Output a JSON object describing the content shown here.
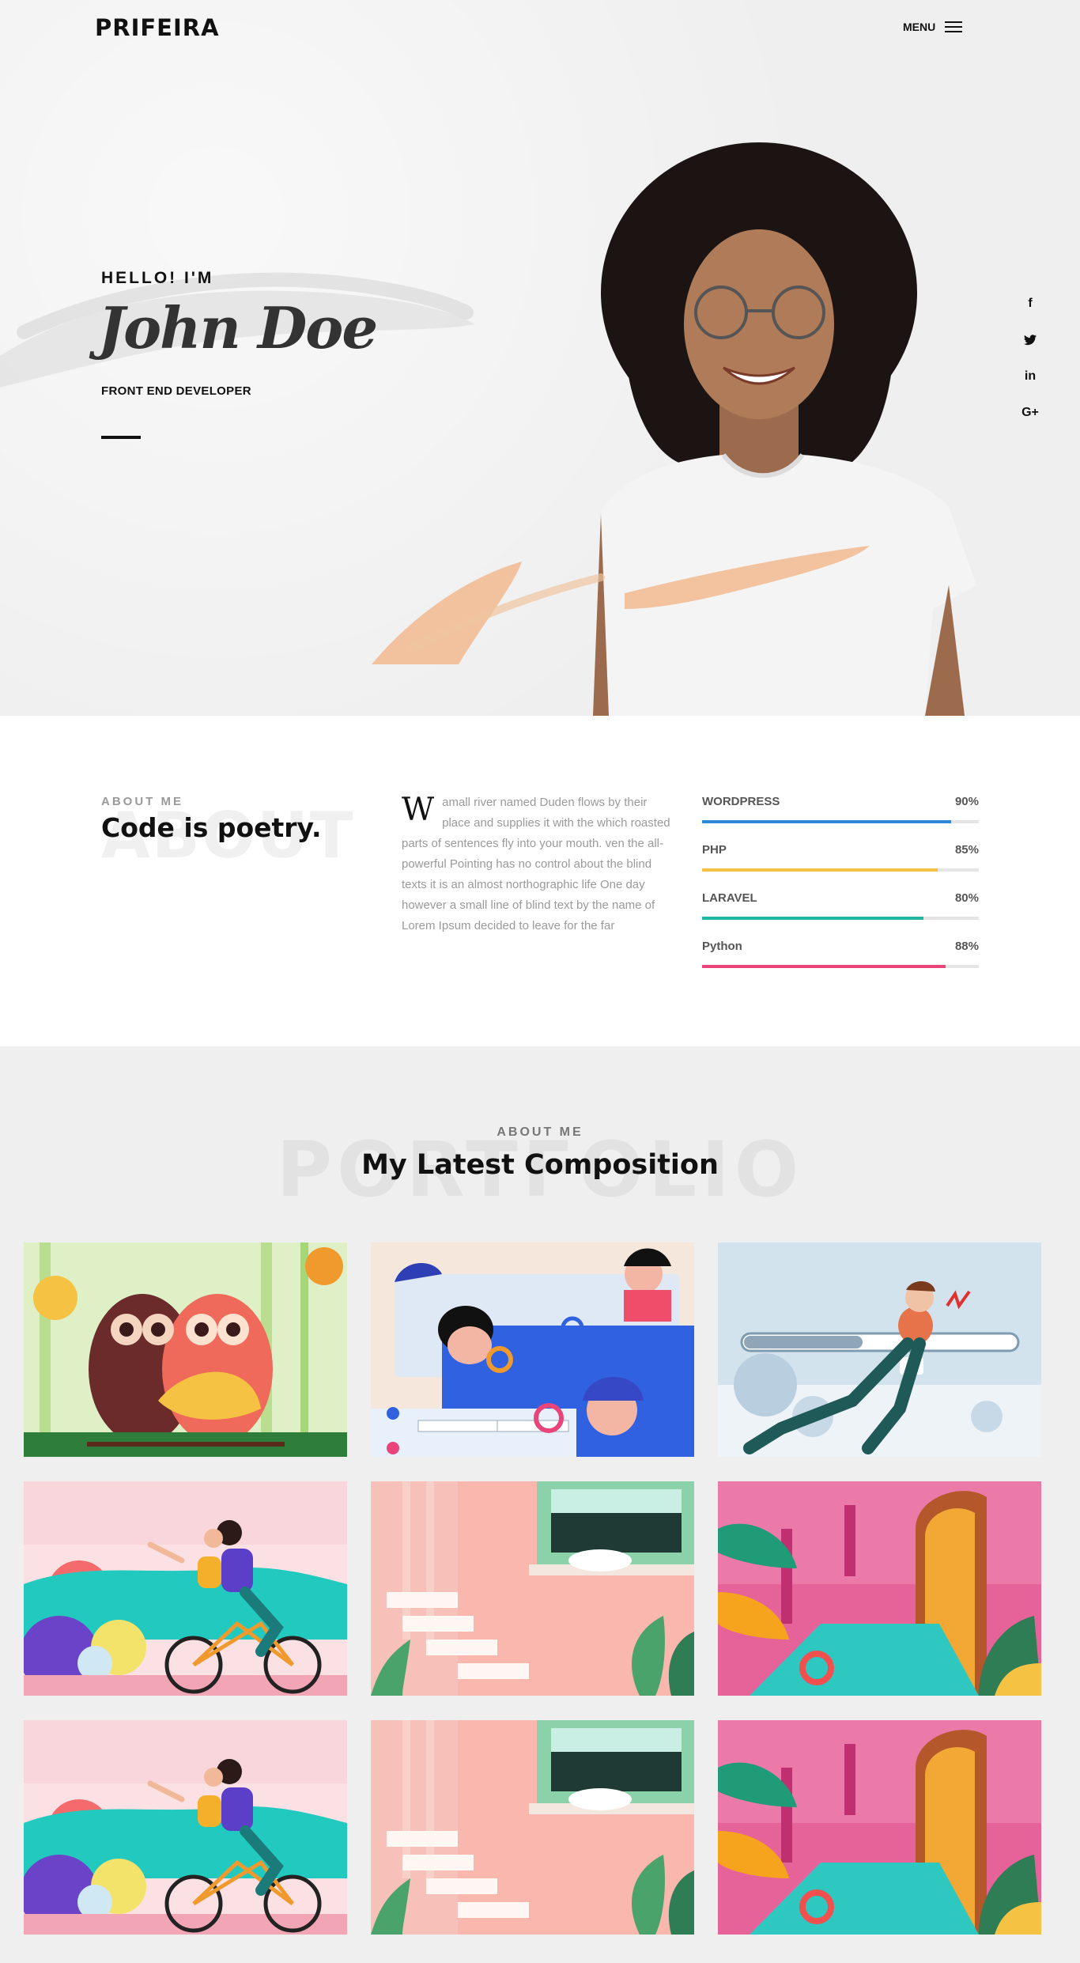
{
  "header": {
    "logo": "PRIFEIRA",
    "menu_label": "MENU"
  },
  "hero": {
    "greeting": "HELLO! I'M",
    "name": "John Doe",
    "role": "FRONT END DEVELOPER",
    "social": [
      {
        "icon": "facebook-icon",
        "glyph": "f"
      },
      {
        "icon": "twitter-icon",
        "glyph": "t"
      },
      {
        "icon": "linkedin-icon",
        "glyph": "in"
      },
      {
        "icon": "google-plus-icon",
        "glyph": "G+"
      }
    ]
  },
  "about": {
    "ghost": "ABOUT",
    "subtitle": "ABOUT ME",
    "title": "Code is poetry.",
    "dropcap": "W",
    "text": "amall river named Duden flows by their place and supplies it with the which roasted parts of sentences fly into your mouth. ven the all-powerful Pointing has no control about the blind texts it is an almost northographic life One day however a small line of blind text by the name of Lorem Ipsum decided to leave for the far",
    "skills": [
      {
        "name": "WORDPRESS",
        "percent": "90%",
        "value": 90,
        "color": "#2f89d8"
      },
      {
        "name": "PHP",
        "percent": "85%",
        "value": 85,
        "color": "#f6c244"
      },
      {
        "name": "LARAVEL",
        "percent": "80%",
        "value": 80,
        "color": "#1fb6a6"
      },
      {
        "name": "Python",
        "percent": "88%",
        "value": 88,
        "color": "#e9457a"
      }
    ]
  },
  "portfolio": {
    "ghost": "PORTFOLIO",
    "subtitle": "ABOUT ME",
    "title": "My Latest Composition",
    "items": [
      {
        "name": "owls-illustration"
      },
      {
        "name": "search-team-illustration"
      },
      {
        "name": "progress-runner-illustration"
      },
      {
        "name": "bicycle-couple-illustration"
      },
      {
        "name": "pink-stairs-cat-illustration"
      },
      {
        "name": "pink-pool-door-illustration"
      },
      {
        "name": "bicycle-couple-illustration"
      },
      {
        "name": "pink-stairs-cat-illustration"
      },
      {
        "name": "pink-pool-door-illustration"
      }
    ]
  },
  "colors": {
    "accent_peach": "#f2b98f",
    "text_dark": "#111111",
    "muted": "#9a9a9a"
  }
}
